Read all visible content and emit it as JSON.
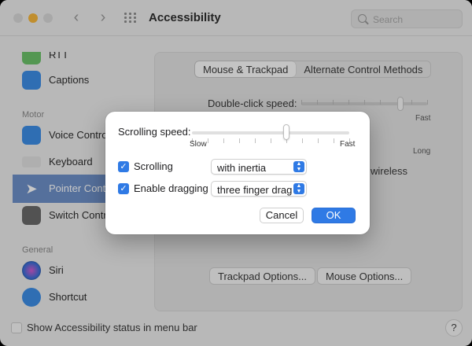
{
  "window": {
    "title": "Accessibility",
    "search_placeholder": "Search"
  },
  "sidebar": {
    "items": [
      {
        "label": "RTT",
        "icon": "rtt-icon"
      },
      {
        "label": "Captions",
        "icon": "captions-icon"
      },
      {
        "label": "Voice Control",
        "icon": "voice-control-icon"
      },
      {
        "label": "Keyboard",
        "icon": "keyboard-icon"
      },
      {
        "label": "Pointer Control",
        "icon": "pointer-icon",
        "selected": true
      },
      {
        "label": "Switch Control",
        "icon": "switch-control-icon"
      },
      {
        "label": "Siri",
        "icon": "siri-icon"
      },
      {
        "label": "Shortcut",
        "icon": "shortcut-icon"
      }
    ],
    "sections": {
      "motor": "Motor",
      "general": "General"
    }
  },
  "main": {
    "tabs": [
      {
        "label": "Mouse & Trackpad",
        "active": true
      },
      {
        "label": "Alternate Control Methods",
        "active": false
      }
    ],
    "double_click_label": "Double-click speed:",
    "fast_label": "Fast",
    "long_label": "Long",
    "wireless_label": "wireless",
    "trackpad_options": "Trackpad Options...",
    "mouse_options": "Mouse Options..."
  },
  "footer": {
    "status_label": "Show Accessibility status in menu bar",
    "help_label": "?"
  },
  "dialog": {
    "scrolling_speed_label": "Scrolling speed:",
    "slow_label": "Slow",
    "fast_label": "Fast",
    "scrolling_speed_level": 0.6,
    "scrolling": {
      "label": "Scrolling",
      "checked": true,
      "value": "with inertia"
    },
    "dragging": {
      "label": "Enable dragging",
      "checked": true,
      "value": "three finger drag"
    },
    "cancel_label": "Cancel",
    "ok_label": "OK"
  },
  "colors": {
    "accent": "#2f7ae5",
    "selected_sidebar": "#6d90c8",
    "minimize": "#f6b73c"
  }
}
